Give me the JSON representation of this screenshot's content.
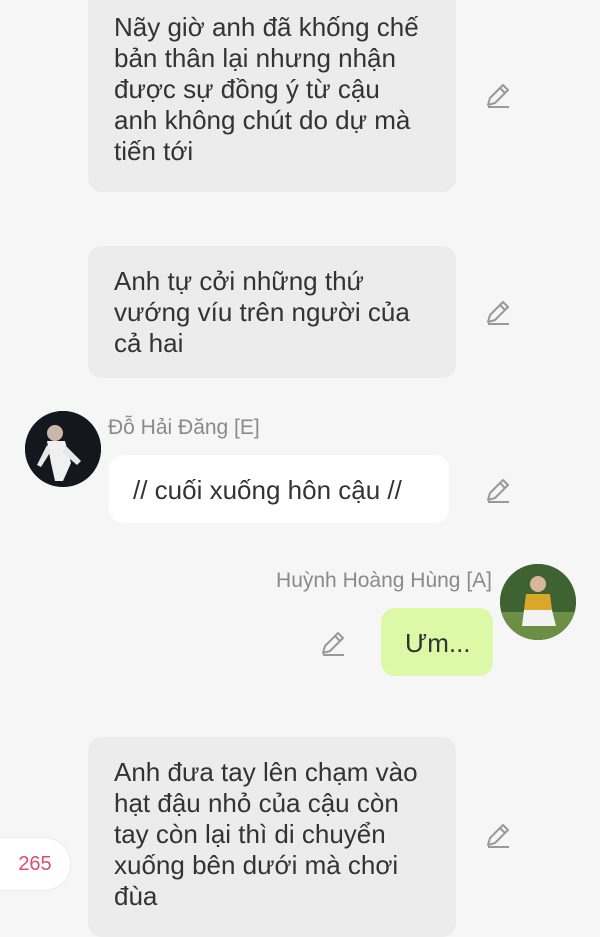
{
  "messages": [
    {
      "type": "narration",
      "text": "Nãy giờ anh đã khống chế bản thân lại nhưng nhận được sự đồng ý từ cậu anh không chút do dự mà tiến tới"
    },
    {
      "type": "narration",
      "text": "Anh tự cởi những thứ vướng víu trên người của cả hai"
    },
    {
      "type": "chat",
      "sender": "Đỗ Hải Đăng [E]",
      "text": "// cuối xuống hôn cậu //"
    },
    {
      "type": "chat",
      "sender": "Huỳnh Hoàng Hùng [A]",
      "text": "Ưm..."
    },
    {
      "type": "narration",
      "text": "Anh đưa tay lên chạm vào hạt đậu nhỏ của cậu còn tay còn lại thì di chuyển xuống bên dưới mà chơi đùa"
    }
  ],
  "comment_count": "265",
  "icons": {
    "edit": "pencil-icon"
  },
  "colors": {
    "narration_bg": "#ececec",
    "self_bubble": "#dcf9a7",
    "other_bubble": "#ffffff",
    "counter_text": "#d9506e"
  }
}
